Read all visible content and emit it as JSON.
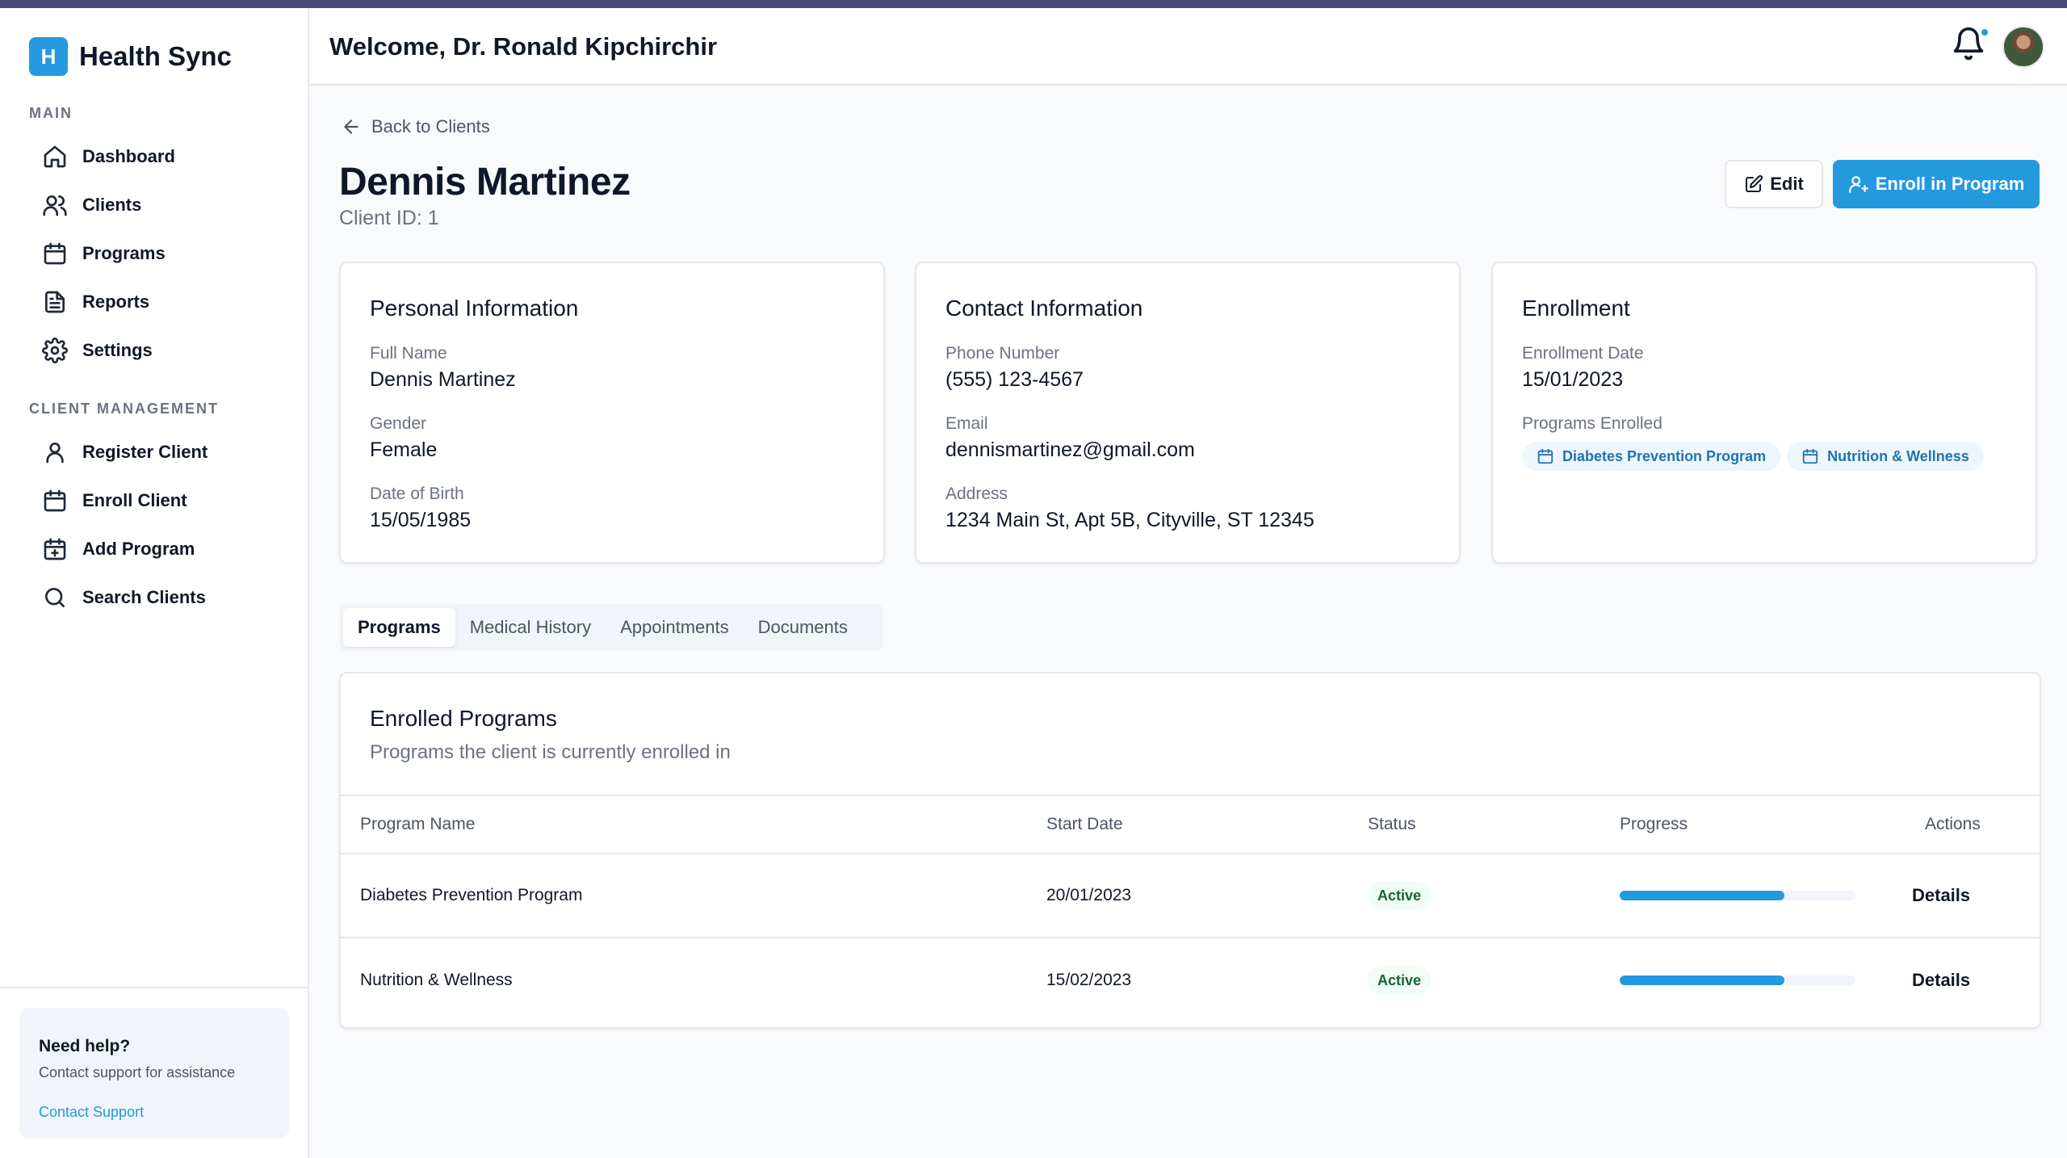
{
  "app": {
    "logo_letter": "H",
    "name": "Health Sync"
  },
  "sidebar": {
    "main_label": "MAIN",
    "main_items": [
      {
        "label": "Dashboard",
        "icon": "home-icon"
      },
      {
        "label": "Clients",
        "icon": "users-icon"
      },
      {
        "label": "Programs",
        "icon": "calendar-icon"
      },
      {
        "label": "Reports",
        "icon": "file-text-icon"
      },
      {
        "label": "Settings",
        "icon": "gear-icon"
      }
    ],
    "client_label": "CLIENT MANAGEMENT",
    "client_items": [
      {
        "label": "Register Client",
        "icon": "user-icon"
      },
      {
        "label": "Enroll Client",
        "icon": "calendar-icon"
      },
      {
        "label": "Add Program",
        "icon": "calendar-plus-icon"
      },
      {
        "label": "Search Clients",
        "icon": "search-icon"
      }
    ],
    "help": {
      "title": "Need help?",
      "subtitle": "Contact support for assistance",
      "link": "Contact Support"
    }
  },
  "header": {
    "welcome": "Welcome, Dr. Ronald Kipchirchir",
    "notification_dot": true
  },
  "page": {
    "back_label": "Back to Clients",
    "client_name": "Dennis Martinez",
    "client_id": "Client ID: 1",
    "edit_label": "Edit",
    "enroll_label": "Enroll in Program"
  },
  "personal": {
    "title": "Personal Information",
    "full_name_label": "Full Name",
    "full_name": "Dennis Martinez",
    "gender_label": "Gender",
    "gender": "Female",
    "dob_label": "Date of Birth",
    "dob": "15/05/1985"
  },
  "contact": {
    "title": "Contact Information",
    "phone_label": "Phone Number",
    "phone": "(555) 123-4567",
    "email_label": "Email",
    "email": "dennismartinez@gmail.com",
    "address_label": "Address",
    "address": "1234 Main St, Apt 5B, Cityville, ST 12345"
  },
  "enrollment": {
    "title": "Enrollment",
    "date_label": "Enrollment Date",
    "date": "15/01/2023",
    "programs_label": "Programs Enrolled",
    "programs": [
      "Diabetes Prevention Program",
      "Nutrition & Wellness"
    ]
  },
  "tabs": [
    "Programs",
    "Medical History",
    "Appointments",
    "Documents"
  ],
  "active_tab": "Programs",
  "programs_table": {
    "title": "Enrolled Programs",
    "subtitle": "Programs the client is currently enrolled in",
    "headers": [
      "Program Name",
      "Start Date",
      "Status",
      "Progress",
      "Actions"
    ],
    "rows": [
      {
        "name": "Diabetes Prevention Program",
        "start": "20/01/2023",
        "status": "Active",
        "progress": 70,
        "action": "Details"
      },
      {
        "name": "Nutrition & Wellness",
        "start": "15/02/2023",
        "status": "Active",
        "progress": 70,
        "action": "Details"
      }
    ]
  },
  "colors": {
    "accent": "#2499e0",
    "top_bar": "#4c4a78",
    "active_badge_bg": "#f0fdf4",
    "active_badge_text": "#166534"
  }
}
